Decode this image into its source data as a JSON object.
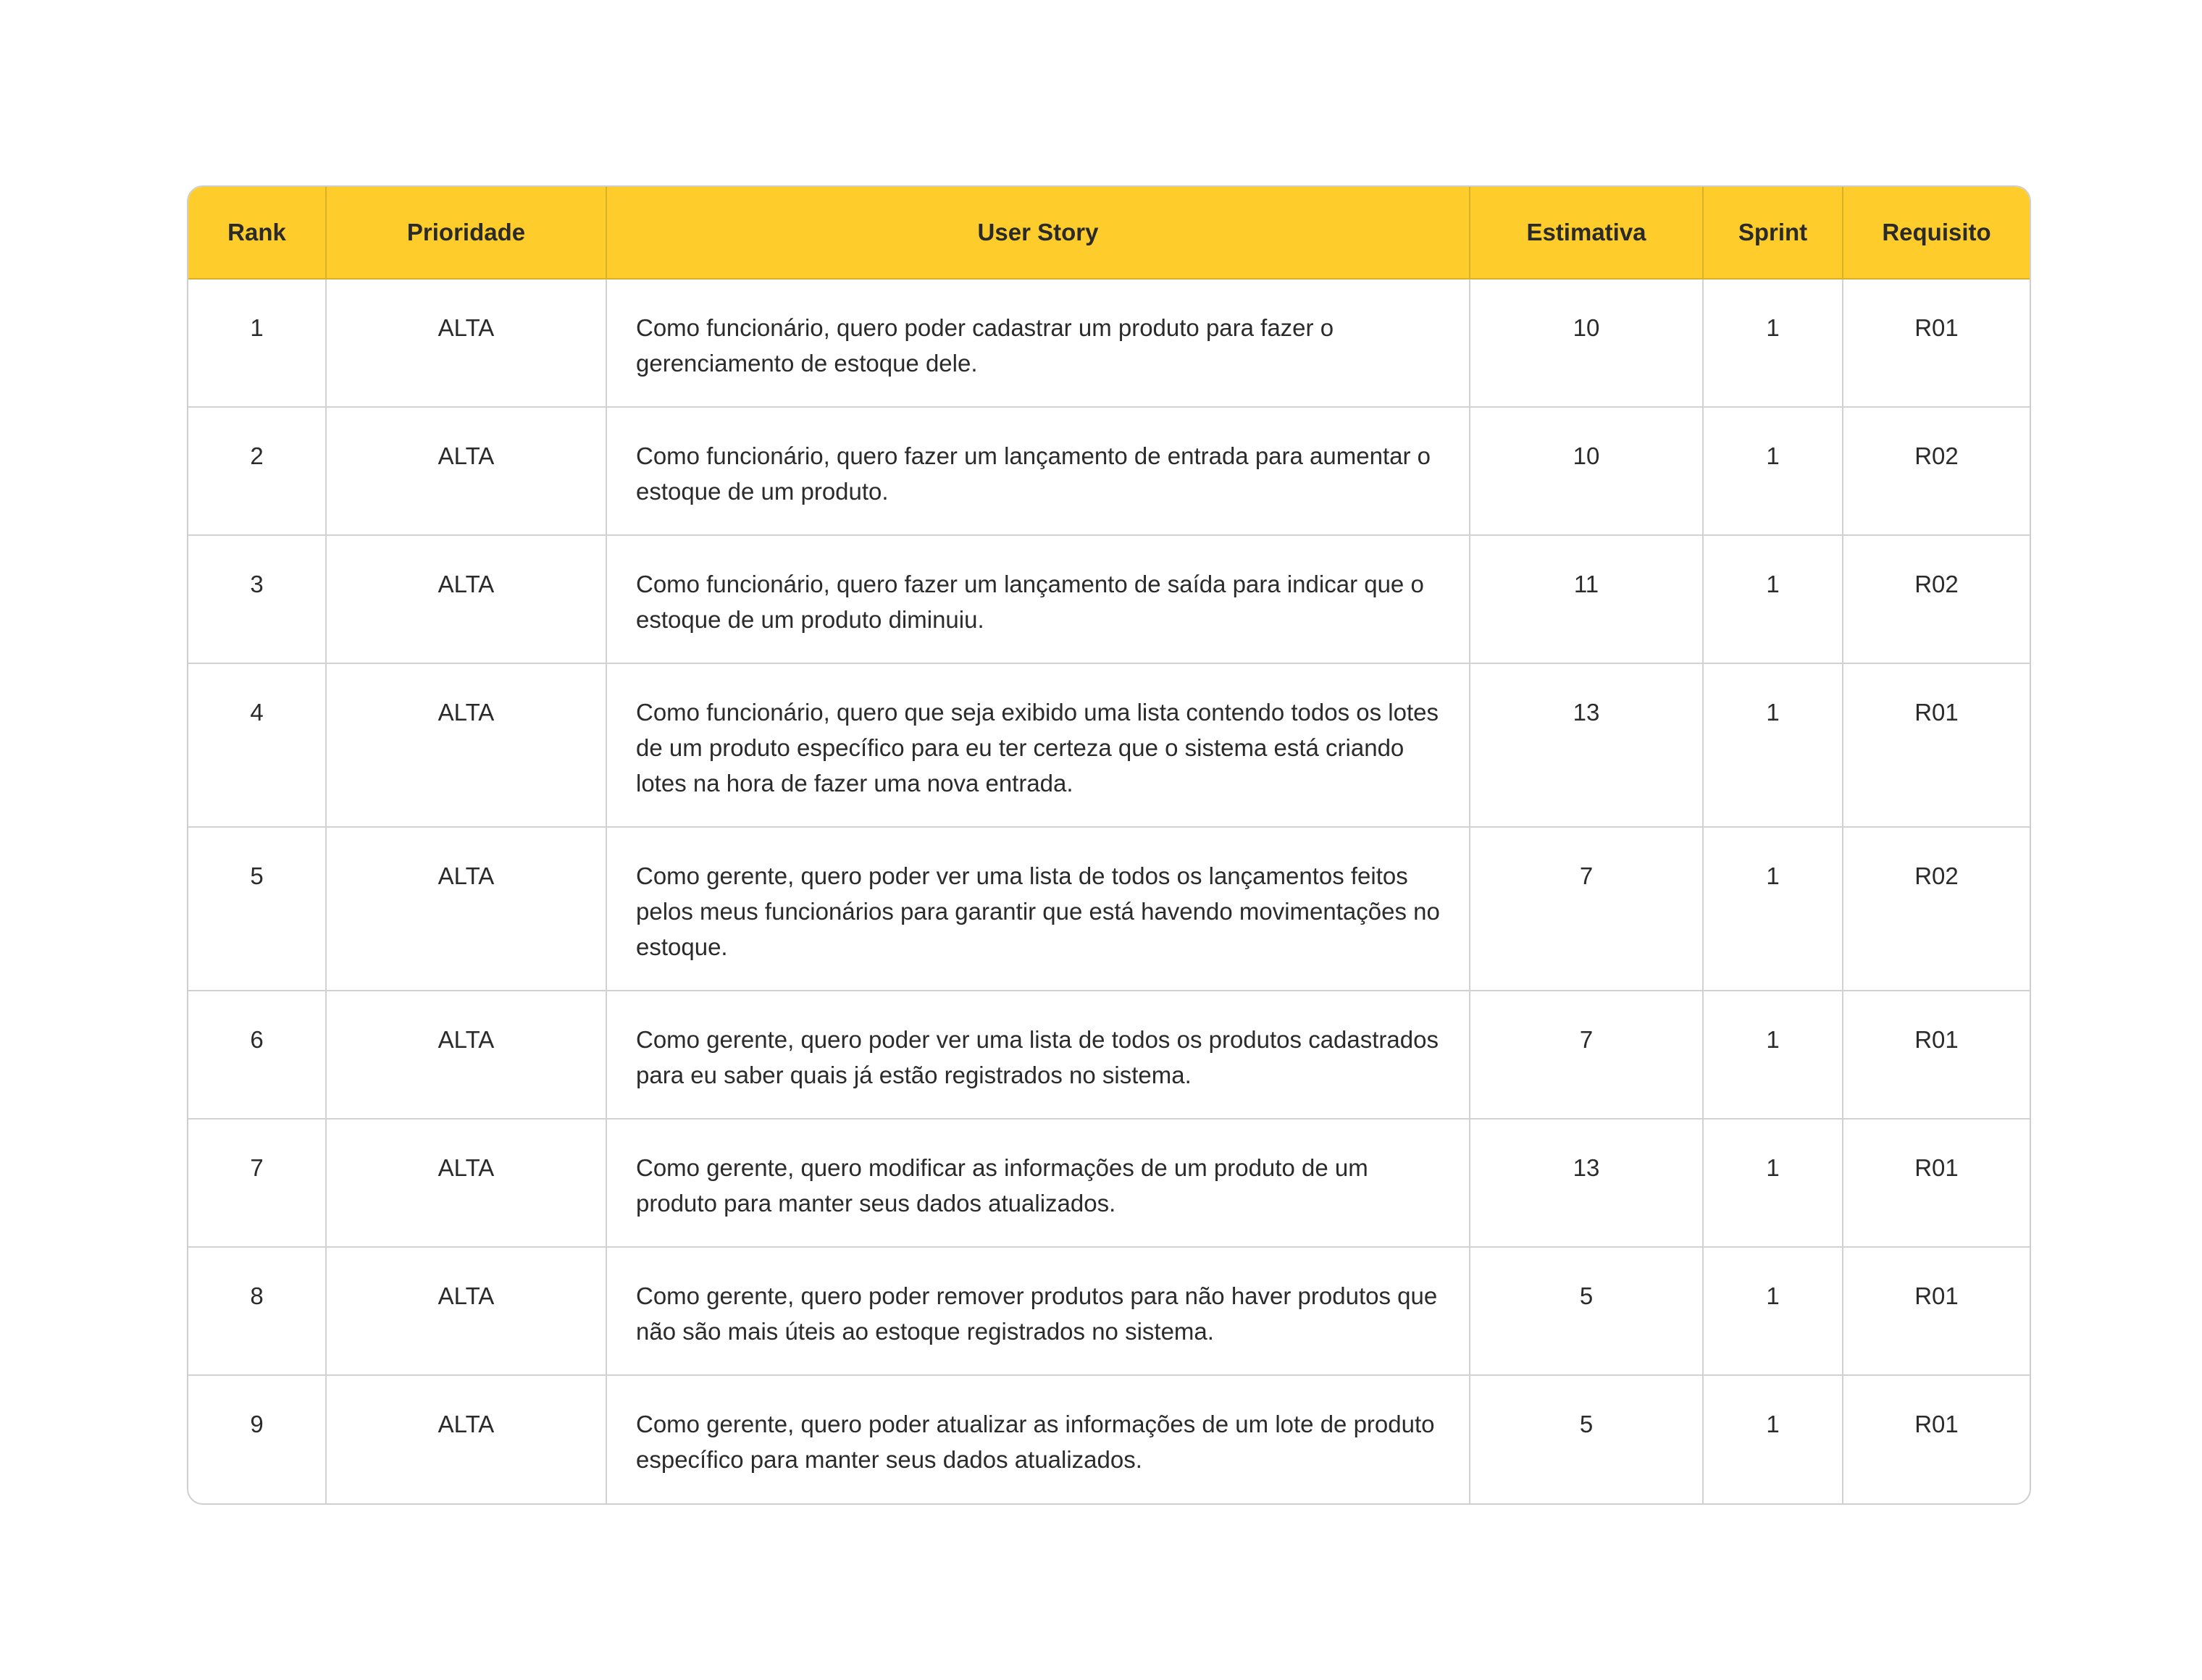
{
  "table": {
    "headers": [
      "Rank",
      "Prioridade",
      "User Story",
      "Estimativa",
      "Sprint",
      "Requisito"
    ],
    "rows": [
      {
        "rank": "1",
        "prioridade": "ALTA",
        "story": "Como funcionário, quero poder cadastrar um produto para fazer o gerenciamento de estoque dele.",
        "estimativa": "10",
        "sprint": "1",
        "requisito": "R01"
      },
      {
        "rank": "2",
        "prioridade": "ALTA",
        "story": "Como funcionário, quero fazer um lançamento de entrada para aumentar o estoque de um produto.",
        "estimativa": "10",
        "sprint": "1",
        "requisito": "R02"
      },
      {
        "rank": "3",
        "prioridade": "ALTA",
        "story": "Como funcionário, quero fazer um lançamento de saída para indicar que o estoque de um produto diminuiu.",
        "estimativa": "11",
        "sprint": "1",
        "requisito": "R02"
      },
      {
        "rank": "4",
        "prioridade": "ALTA",
        "story": "Como funcionário, quero que seja exibido uma lista contendo todos os lotes de um produto específico para eu ter certeza que o sistema está criando lotes na hora de fazer uma nova entrada.",
        "estimativa": "13",
        "sprint": "1",
        "requisito": "R01"
      },
      {
        "rank": "5",
        "prioridade": "ALTA",
        "story": "Como gerente, quero poder ver uma lista de todos os lançamentos feitos pelos meus funcionários para garantir que está havendo movimentações no estoque.",
        "estimativa": "7",
        "sprint": "1",
        "requisito": "R02"
      },
      {
        "rank": "6",
        "prioridade": "ALTA",
        "story": "Como gerente, quero poder ver uma lista de todos os produtos cadastrados para eu saber quais já estão registrados no sistema.",
        "estimativa": "7",
        "sprint": "1",
        "requisito": "R01"
      },
      {
        "rank": "7",
        "prioridade": "ALTA",
        "story": "Como gerente, quero modificar as informações de um produto de um produto para manter seus dados atualizados.",
        "estimativa": "13",
        "sprint": "1",
        "requisito": "R01"
      },
      {
        "rank": "8",
        "prioridade": "ALTA",
        "story": "Como gerente, quero poder remover produtos para não haver produtos que não são mais úteis ao estoque registrados no sistema.",
        "estimativa": "5",
        "sprint": "1",
        "requisito": "R01"
      },
      {
        "rank": "9",
        "prioridade": "ALTA",
        "story": "Como gerente, quero poder atualizar as informações de um lote de produto específico para manter seus dados atualizados.",
        "estimativa": "5",
        "sprint": "1",
        "requisito": "R01"
      }
    ]
  },
  "colors": {
    "header_bg": "#fecd2b",
    "grid": "#d2d2d2",
    "text": "#2b2b2b"
  }
}
